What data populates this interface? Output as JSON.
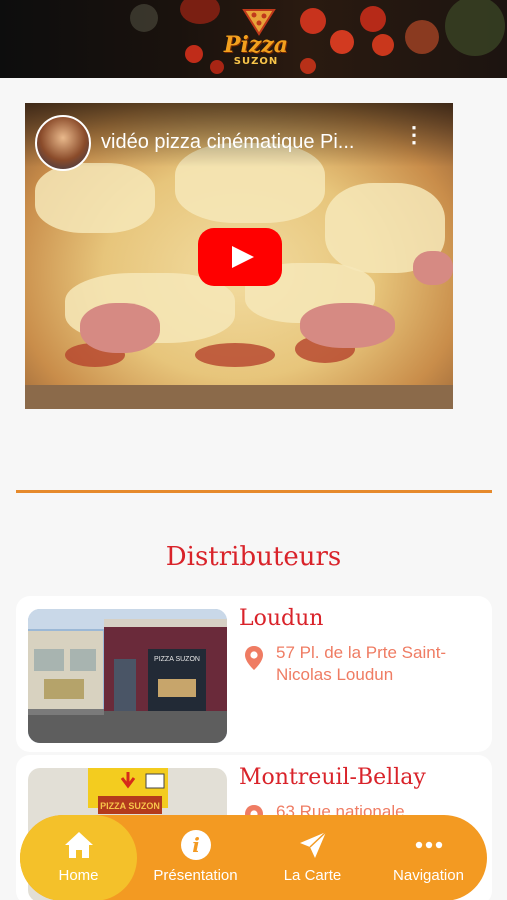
{
  "header": {
    "logo_text": "Pizza",
    "logo_sub": "SUZON"
  },
  "video": {
    "title": "vidéo pizza cinématique Pi...",
    "channel": "channel-avatar"
  },
  "section": {
    "title": "Distributeurs"
  },
  "distributors": [
    {
      "name": "Loudun",
      "address": "57 Pl. de la Prte Saint-Nicolas Loudun",
      "photo_sign": "PIZZA SUZON"
    },
    {
      "name": "Montreuil-Bellay",
      "address": "63 Rue nationale",
      "photo_sign": "PIZZA SUZON"
    }
  ],
  "nav": {
    "items": [
      {
        "label": "Home",
        "icon": "home-icon",
        "active": true
      },
      {
        "label": "Présentation",
        "icon": "info-icon",
        "active": false
      },
      {
        "label": "La Carte",
        "icon": "send-icon",
        "active": false
      },
      {
        "label": "Navigation",
        "icon": "more-icon",
        "active": false
      }
    ]
  },
  "colors": {
    "accent": "#f39a22",
    "active_nav": "#f4c12a",
    "title_red": "#d9232a",
    "address": "#ef7c63",
    "divider": "#e68a2c"
  }
}
